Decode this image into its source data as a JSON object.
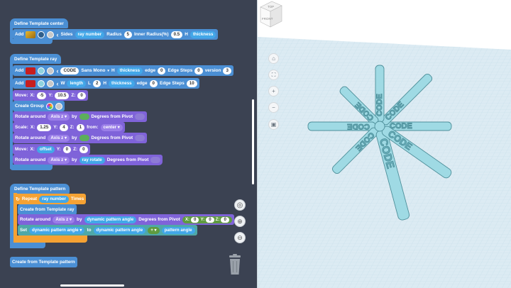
{
  "workspace": {
    "template_center": {
      "title": "Define Template center",
      "add": "Add",
      "sides": "Sides",
      "ray_number": "ray number",
      "radius": "Radius",
      "radius_value": "5",
      "inner_radius": "Inner Radius(%)",
      "inner_value": "0.5",
      "h": "H",
      "thickness": "thickness"
    },
    "template_ray": {
      "title": "Define Template ray",
      "add": "Add",
      "text_value": "CODE",
      "font": "Sans Mono",
      "h": "H",
      "thickness": "thickness",
      "edge": "edge",
      "edge_value": "0",
      "edge_steps": "Edge Steps",
      "edge_steps_value": "0",
      "version": "version",
      "version_value": "3",
      "w": "W",
      "length": "length",
      "l": "L",
      "l_value": "2",
      "edge_value_2": "0",
      "edge_steps_value_2": "10",
      "move": "Move:",
      "x": "X:",
      "y": "Y:",
      "z": "Z:",
      "move_x": "-5",
      "move_y": "10.5",
      "move_z": "0",
      "create_group": "Create Group",
      "rotate_around": "Rotate around",
      "axis_z": "Axis z",
      "by": "by",
      "degrees_from_pivot": "Degrees from Pivot",
      "scale": "Scale:",
      "scale_x": "1.25",
      "scale_y": "4",
      "scale_z": "1",
      "from": "from:",
      "center": "center",
      "offset": "offset",
      "move2_y": "0",
      "move2_z": "0",
      "ray_rotate": "ray rotate"
    },
    "template_pattern": {
      "title": "Define Template pattern",
      "repeat": "Repeat",
      "ray_number": "ray number",
      "times": "Times",
      "create_from": "Create from Template ray",
      "rotate_around": "Rotate around",
      "axis_z": "Axis z",
      "by": "by",
      "dynamic_pattern_angle": "dynamic pattern angle",
      "degrees_from_pivot": "Degrees from Pivot",
      "x": "X:",
      "y": "Y:",
      "z": "Z:",
      "pivot_x": "0",
      "pivot_y": "0",
      "pivot_z": "0",
      "set": "Set",
      "to": "to",
      "plus": "+",
      "pattern_angle": "pattern angle"
    },
    "create_pattern": "Create from Template pattern"
  },
  "viewport": {
    "viewcube_top": "TOP",
    "viewcube_front": "FRONT",
    "model_text": "CODE"
  },
  "colors": {
    "workspace_bg": "#3b4252",
    "model": "#8fd3de",
    "grid": "#cfe3ec",
    "block_blue": "#4b8fd4",
    "block_purple": "#7f63d9",
    "block_orange": "#f5a233"
  }
}
